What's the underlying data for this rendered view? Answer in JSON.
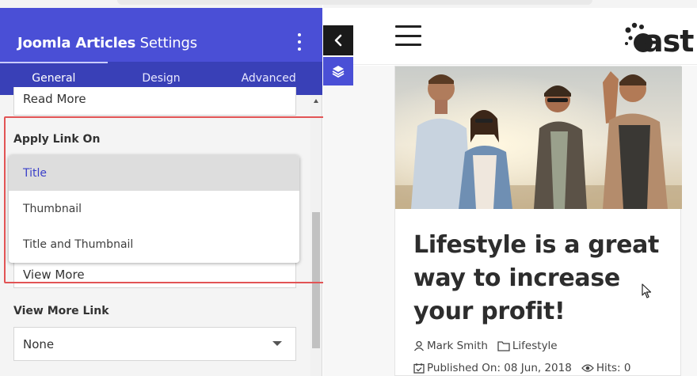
{
  "settings_panel": {
    "title_bold": "Joomla Articles",
    "title_light": "Settings",
    "tabs": [
      {
        "label": "General",
        "active": true
      },
      {
        "label": "Design",
        "active": false
      },
      {
        "label": "Advanced",
        "active": false
      }
    ],
    "read_more_value": "Read More",
    "apply_link_label": "Apply Link On",
    "apply_link_options": [
      "Title",
      "Thumbnail",
      "Title and Thumbnail"
    ],
    "apply_link_selected": "Title",
    "view_more_value": "View More",
    "view_more_link_label": "View More Link",
    "view_more_link_value": "None"
  },
  "preview": {
    "logo_text": "ast",
    "article": {
      "title": "Lifestyle is a great way to increase your profit!",
      "author": "Mark Smith",
      "category": "Lifestyle",
      "published": "Published On: 08 Jun, 2018",
      "hits": "Hits: 0"
    }
  },
  "colors": {
    "header": "#4a4fd6",
    "tabs": "#3940b7",
    "highlight_border": "#e25455",
    "selected_option_text": "#3a3fc9"
  }
}
